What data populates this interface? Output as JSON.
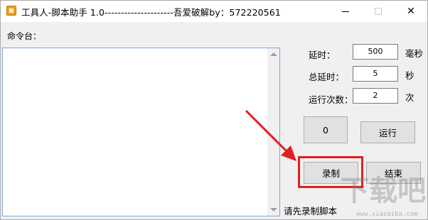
{
  "window": {
    "title": "工具人-脚本助手 1.0---------------------吾爱破解by：572220561",
    "icons": {
      "app": "app-icon",
      "minimize": "minimize-icon",
      "maximize": "maximize-icon",
      "close": "close-icon"
    },
    "close_glyph": "✕"
  },
  "console": {
    "label": "命令台：",
    "content": ""
  },
  "settings": {
    "delay": {
      "label": "延时：",
      "value": "500",
      "unit": "毫秒"
    },
    "total_delay": {
      "label": "总延时：",
      "value": "5",
      "unit": "秒"
    },
    "run_count": {
      "label": "运行次数：",
      "value": "2",
      "unit": "次"
    }
  },
  "buttons": {
    "counter": "0",
    "run": "运行",
    "record": "录制",
    "stop": "结束"
  },
  "status": "请先录制脚本",
  "annotation": {
    "highlight_color": "#e02020"
  },
  "watermark": {
    "text": "下载吧",
    "sub": "www.xiazaiba.com"
  }
}
